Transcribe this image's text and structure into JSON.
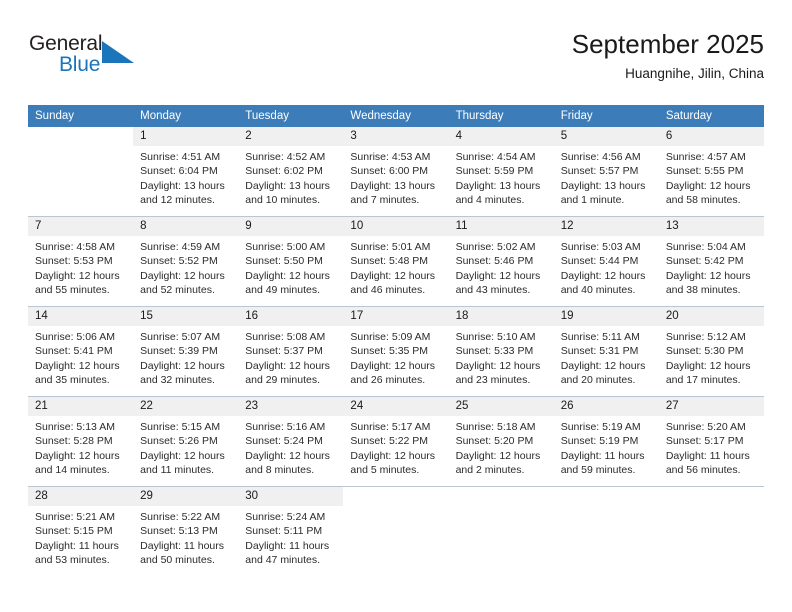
{
  "brand": {
    "name_part1": "General",
    "name_part2": "Blue",
    "triangle_color": "#1b75bb",
    "text_color": "#231f20"
  },
  "header": {
    "title": "September 2025",
    "subtitle": "Huangnihe, Jilin, China"
  },
  "calendar": {
    "header_bg": "#3b7cb9",
    "header_text_color": "#ffffff",
    "daynum_bg": "#f0f0f0",
    "weekday_headers": [
      "Sunday",
      "Monday",
      "Tuesday",
      "Wednesday",
      "Thursday",
      "Friday",
      "Saturday"
    ],
    "weeks": [
      [
        {
          "day": "",
          "empty": true,
          "sunrise": "",
          "sunset": "",
          "daylight_line1": "",
          "daylight_line2": ""
        },
        {
          "day": "1",
          "empty": false,
          "sunrise": "Sunrise: 4:51 AM",
          "sunset": "Sunset: 6:04 PM",
          "daylight_line1": "Daylight: 13 hours",
          "daylight_line2": "and 12 minutes."
        },
        {
          "day": "2",
          "empty": false,
          "sunrise": "Sunrise: 4:52 AM",
          "sunset": "Sunset: 6:02 PM",
          "daylight_line1": "Daylight: 13 hours",
          "daylight_line2": "and 10 minutes."
        },
        {
          "day": "3",
          "empty": false,
          "sunrise": "Sunrise: 4:53 AM",
          "sunset": "Sunset: 6:00 PM",
          "daylight_line1": "Daylight: 13 hours",
          "daylight_line2": "and 7 minutes."
        },
        {
          "day": "4",
          "empty": false,
          "sunrise": "Sunrise: 4:54 AM",
          "sunset": "Sunset: 5:59 PM",
          "daylight_line1": "Daylight: 13 hours",
          "daylight_line2": "and 4 minutes."
        },
        {
          "day": "5",
          "empty": false,
          "sunrise": "Sunrise: 4:56 AM",
          "sunset": "Sunset: 5:57 PM",
          "daylight_line1": "Daylight: 13 hours",
          "daylight_line2": "and 1 minute."
        },
        {
          "day": "6",
          "empty": false,
          "sunrise": "Sunrise: 4:57 AM",
          "sunset": "Sunset: 5:55 PM",
          "daylight_line1": "Daylight: 12 hours",
          "daylight_line2": "and 58 minutes."
        }
      ],
      [
        {
          "day": "7",
          "empty": false,
          "sunrise": "Sunrise: 4:58 AM",
          "sunset": "Sunset: 5:53 PM",
          "daylight_line1": "Daylight: 12 hours",
          "daylight_line2": "and 55 minutes."
        },
        {
          "day": "8",
          "empty": false,
          "sunrise": "Sunrise: 4:59 AM",
          "sunset": "Sunset: 5:52 PM",
          "daylight_line1": "Daylight: 12 hours",
          "daylight_line2": "and 52 minutes."
        },
        {
          "day": "9",
          "empty": false,
          "sunrise": "Sunrise: 5:00 AM",
          "sunset": "Sunset: 5:50 PM",
          "daylight_line1": "Daylight: 12 hours",
          "daylight_line2": "and 49 minutes."
        },
        {
          "day": "10",
          "empty": false,
          "sunrise": "Sunrise: 5:01 AM",
          "sunset": "Sunset: 5:48 PM",
          "daylight_line1": "Daylight: 12 hours",
          "daylight_line2": "and 46 minutes."
        },
        {
          "day": "11",
          "empty": false,
          "sunrise": "Sunrise: 5:02 AM",
          "sunset": "Sunset: 5:46 PM",
          "daylight_line1": "Daylight: 12 hours",
          "daylight_line2": "and 43 minutes."
        },
        {
          "day": "12",
          "empty": false,
          "sunrise": "Sunrise: 5:03 AM",
          "sunset": "Sunset: 5:44 PM",
          "daylight_line1": "Daylight: 12 hours",
          "daylight_line2": "and 40 minutes."
        },
        {
          "day": "13",
          "empty": false,
          "sunrise": "Sunrise: 5:04 AM",
          "sunset": "Sunset: 5:42 PM",
          "daylight_line1": "Daylight: 12 hours",
          "daylight_line2": "and 38 minutes."
        }
      ],
      [
        {
          "day": "14",
          "empty": false,
          "sunrise": "Sunrise: 5:06 AM",
          "sunset": "Sunset: 5:41 PM",
          "daylight_line1": "Daylight: 12 hours",
          "daylight_line2": "and 35 minutes."
        },
        {
          "day": "15",
          "empty": false,
          "sunrise": "Sunrise: 5:07 AM",
          "sunset": "Sunset: 5:39 PM",
          "daylight_line1": "Daylight: 12 hours",
          "daylight_line2": "and 32 minutes."
        },
        {
          "day": "16",
          "empty": false,
          "sunrise": "Sunrise: 5:08 AM",
          "sunset": "Sunset: 5:37 PM",
          "daylight_line1": "Daylight: 12 hours",
          "daylight_line2": "and 29 minutes."
        },
        {
          "day": "17",
          "empty": false,
          "sunrise": "Sunrise: 5:09 AM",
          "sunset": "Sunset: 5:35 PM",
          "daylight_line1": "Daylight: 12 hours",
          "daylight_line2": "and 26 minutes."
        },
        {
          "day": "18",
          "empty": false,
          "sunrise": "Sunrise: 5:10 AM",
          "sunset": "Sunset: 5:33 PM",
          "daylight_line1": "Daylight: 12 hours",
          "daylight_line2": "and 23 minutes."
        },
        {
          "day": "19",
          "empty": false,
          "sunrise": "Sunrise: 5:11 AM",
          "sunset": "Sunset: 5:31 PM",
          "daylight_line1": "Daylight: 12 hours",
          "daylight_line2": "and 20 minutes."
        },
        {
          "day": "20",
          "empty": false,
          "sunrise": "Sunrise: 5:12 AM",
          "sunset": "Sunset: 5:30 PM",
          "daylight_line1": "Daylight: 12 hours",
          "daylight_line2": "and 17 minutes."
        }
      ],
      [
        {
          "day": "21",
          "empty": false,
          "sunrise": "Sunrise: 5:13 AM",
          "sunset": "Sunset: 5:28 PM",
          "daylight_line1": "Daylight: 12 hours",
          "daylight_line2": "and 14 minutes."
        },
        {
          "day": "22",
          "empty": false,
          "sunrise": "Sunrise: 5:15 AM",
          "sunset": "Sunset: 5:26 PM",
          "daylight_line1": "Daylight: 12 hours",
          "daylight_line2": "and 11 minutes."
        },
        {
          "day": "23",
          "empty": false,
          "sunrise": "Sunrise: 5:16 AM",
          "sunset": "Sunset: 5:24 PM",
          "daylight_line1": "Daylight: 12 hours",
          "daylight_line2": "and 8 minutes."
        },
        {
          "day": "24",
          "empty": false,
          "sunrise": "Sunrise: 5:17 AM",
          "sunset": "Sunset: 5:22 PM",
          "daylight_line1": "Daylight: 12 hours",
          "daylight_line2": "and 5 minutes."
        },
        {
          "day": "25",
          "empty": false,
          "sunrise": "Sunrise: 5:18 AM",
          "sunset": "Sunset: 5:20 PM",
          "daylight_line1": "Daylight: 12 hours",
          "daylight_line2": "and 2 minutes."
        },
        {
          "day": "26",
          "empty": false,
          "sunrise": "Sunrise: 5:19 AM",
          "sunset": "Sunset: 5:19 PM",
          "daylight_line1": "Daylight: 11 hours",
          "daylight_line2": "and 59 minutes."
        },
        {
          "day": "27",
          "empty": false,
          "sunrise": "Sunrise: 5:20 AM",
          "sunset": "Sunset: 5:17 PM",
          "daylight_line1": "Daylight: 11 hours",
          "daylight_line2": "and 56 minutes."
        }
      ],
      [
        {
          "day": "28",
          "empty": false,
          "sunrise": "Sunrise: 5:21 AM",
          "sunset": "Sunset: 5:15 PM",
          "daylight_line1": "Daylight: 11 hours",
          "daylight_line2": "and 53 minutes."
        },
        {
          "day": "29",
          "empty": false,
          "sunrise": "Sunrise: 5:22 AM",
          "sunset": "Sunset: 5:13 PM",
          "daylight_line1": "Daylight: 11 hours",
          "daylight_line2": "and 50 minutes."
        },
        {
          "day": "30",
          "empty": false,
          "sunrise": "Sunrise: 5:24 AM",
          "sunset": "Sunset: 5:11 PM",
          "daylight_line1": "Daylight: 11 hours",
          "daylight_line2": "and 47 minutes."
        },
        {
          "day": "",
          "empty": true,
          "sunrise": "",
          "sunset": "",
          "daylight_line1": "",
          "daylight_line2": ""
        },
        {
          "day": "",
          "empty": true,
          "sunrise": "",
          "sunset": "",
          "daylight_line1": "",
          "daylight_line2": ""
        },
        {
          "day": "",
          "empty": true,
          "sunrise": "",
          "sunset": "",
          "daylight_line1": "",
          "daylight_line2": ""
        },
        {
          "day": "",
          "empty": true,
          "sunrise": "",
          "sunset": "",
          "daylight_line1": "",
          "daylight_line2": ""
        }
      ]
    ]
  }
}
